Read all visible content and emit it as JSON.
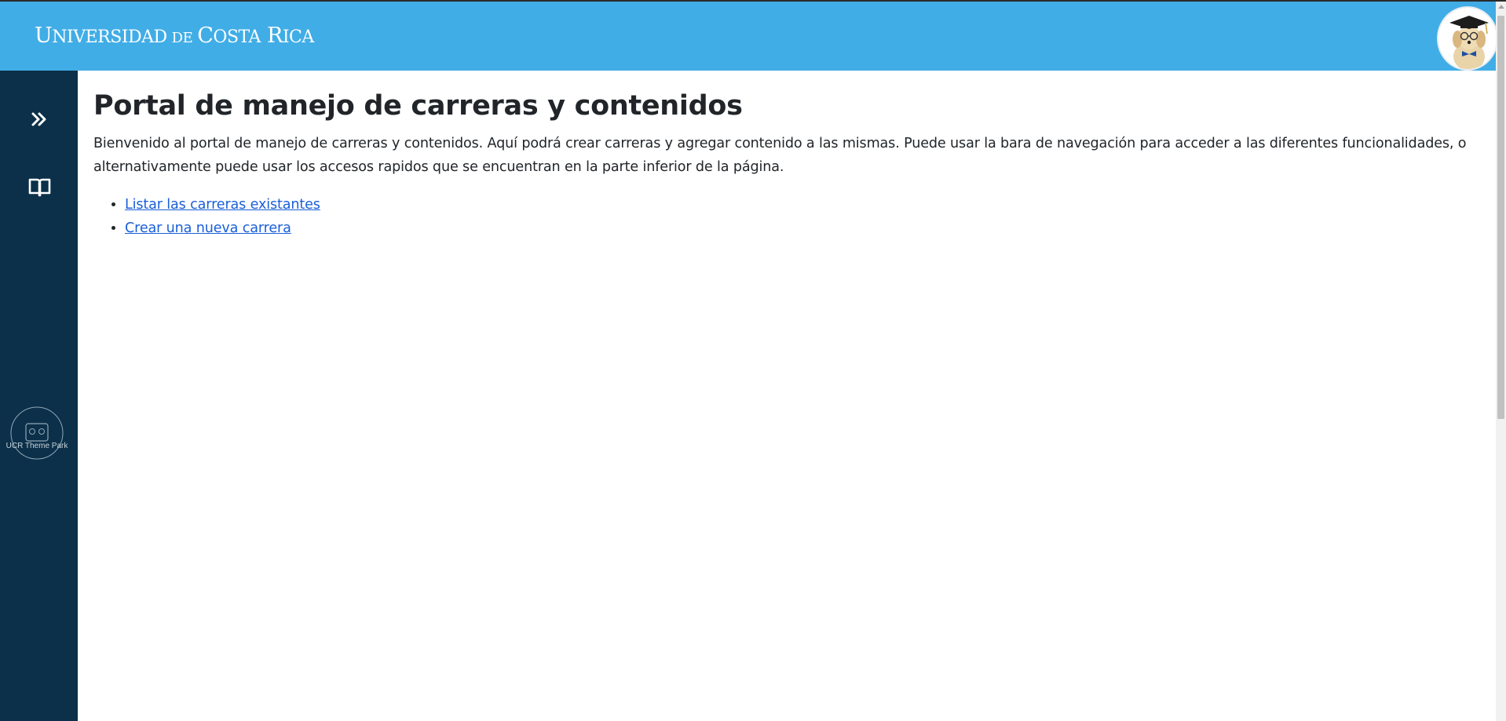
{
  "header": {
    "brand_parts": {
      "u": "U",
      "niversidad": "NIVERSIDAD",
      "de": "DE",
      "c": "C",
      "osta": "OSTA",
      "r": "R",
      "ica": "ICA"
    },
    "avatar_icon": "graduate-dog-avatar-icon",
    "background_color": "#41ade6"
  },
  "sidebar": {
    "background_color": "#0c3049",
    "items": [
      {
        "icon": "chevrons-right-icon"
      },
      {
        "icon": "open-book-icon"
      }
    ],
    "logo_text": "UCR Theme Park"
  },
  "main": {
    "title": "Portal de manejo de carreras y contenidos",
    "intro": "Bienvenido al portal de manejo de carreras y contenidos. Aquí podrá crear carreras y agregar contenido a las mismas. Puede usar la bara de navegación para acceder a las diferentes funcionalidades, o alternativamente puede usar los accesos rapidos que se encuentran en la parte inferior de la página.",
    "links": [
      {
        "label": "Listar las carreras existantes"
      },
      {
        "label": "Crear una nueva carrera"
      }
    ],
    "link_color": "#1a5fd9"
  }
}
